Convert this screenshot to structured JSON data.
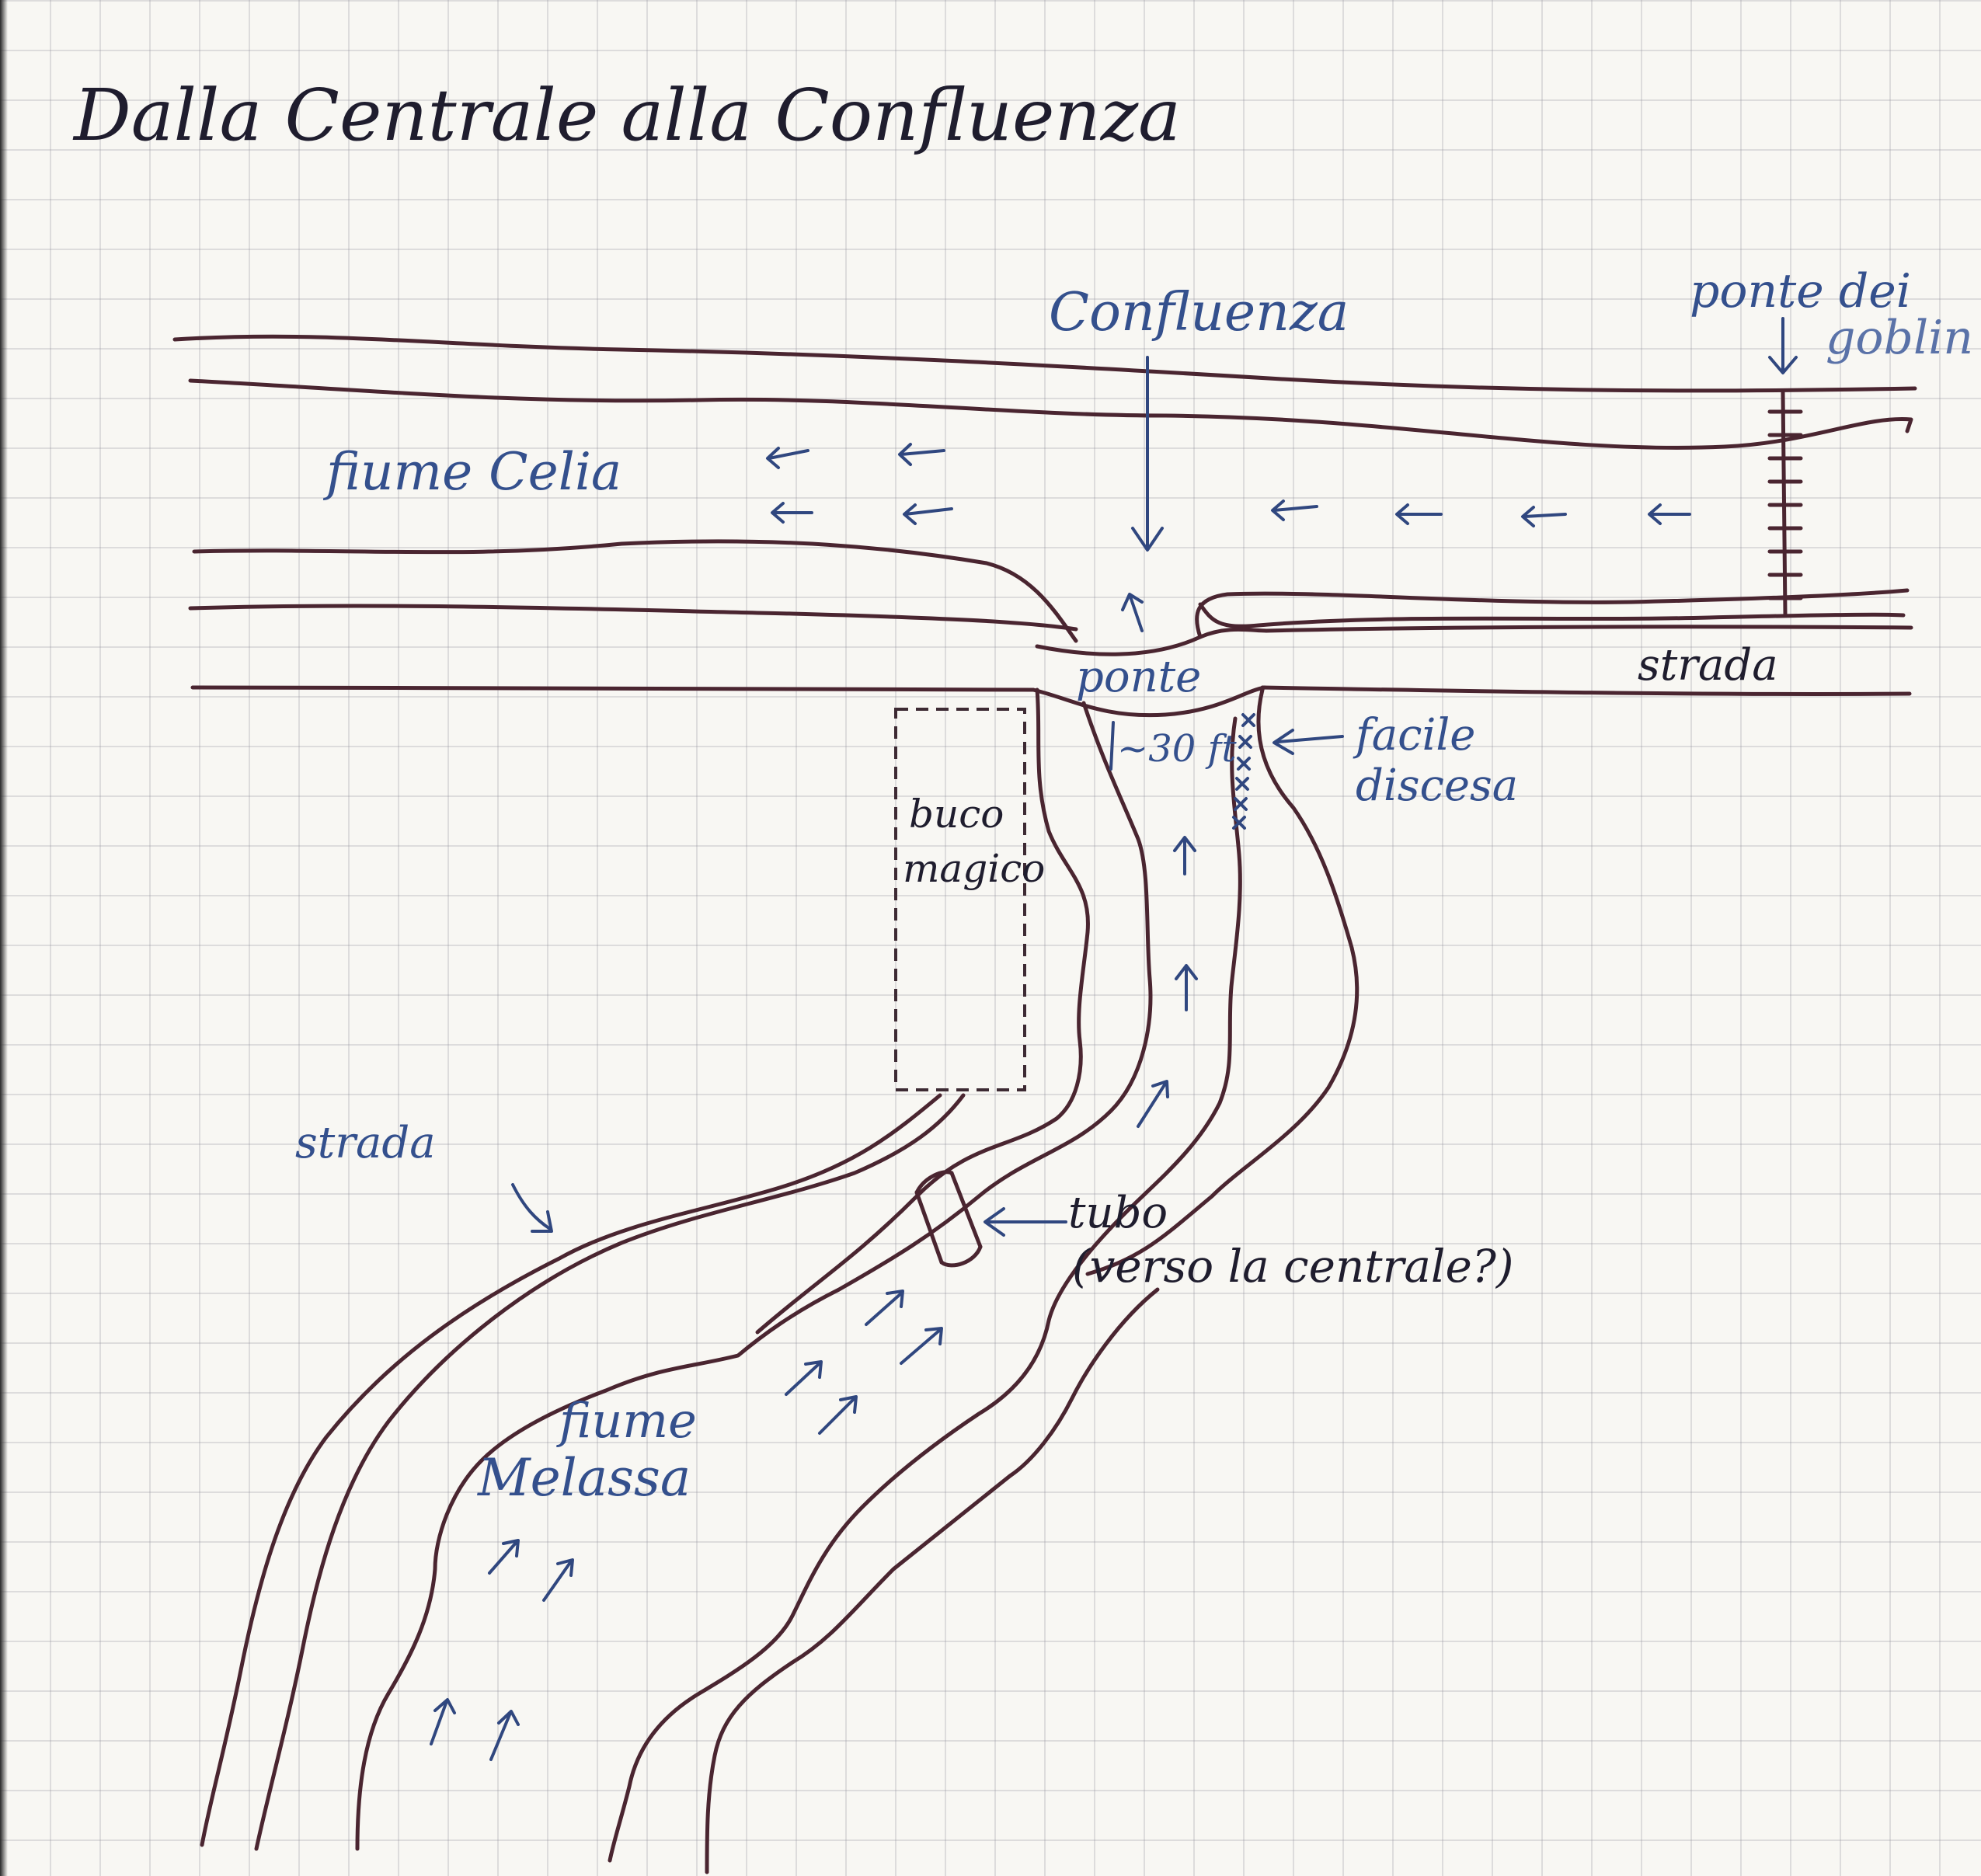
{
  "title": "Dalla Centrale alla Confluenza",
  "labels": {
    "confluenza": "Confluenza",
    "ponte_dei_goblin_line1": "ponte dei",
    "ponte_dei_goblin_line2": "goblin",
    "fiume_celia": "fiume Celia",
    "ponte": "ponte",
    "strada_top": "strada",
    "drop_height": "~30 ft",
    "facile_discesa_line1": "facile",
    "facile_discesa_line2": "discesa",
    "buco_magico_line1": "buco",
    "buco_magico_line2": "magico",
    "strada_left": "strada",
    "tubo": "tubo",
    "verso_la_centrale": "(verso la centrale?)",
    "fiume_melassa_line1": "fiume",
    "fiume_melassa_line2": "Melassa"
  },
  "colors": {
    "ink_dark": "#4a2530",
    "ink_blue": "#30477f",
    "paper": "#f8f7f3",
    "grid": "#b6b6be"
  }
}
